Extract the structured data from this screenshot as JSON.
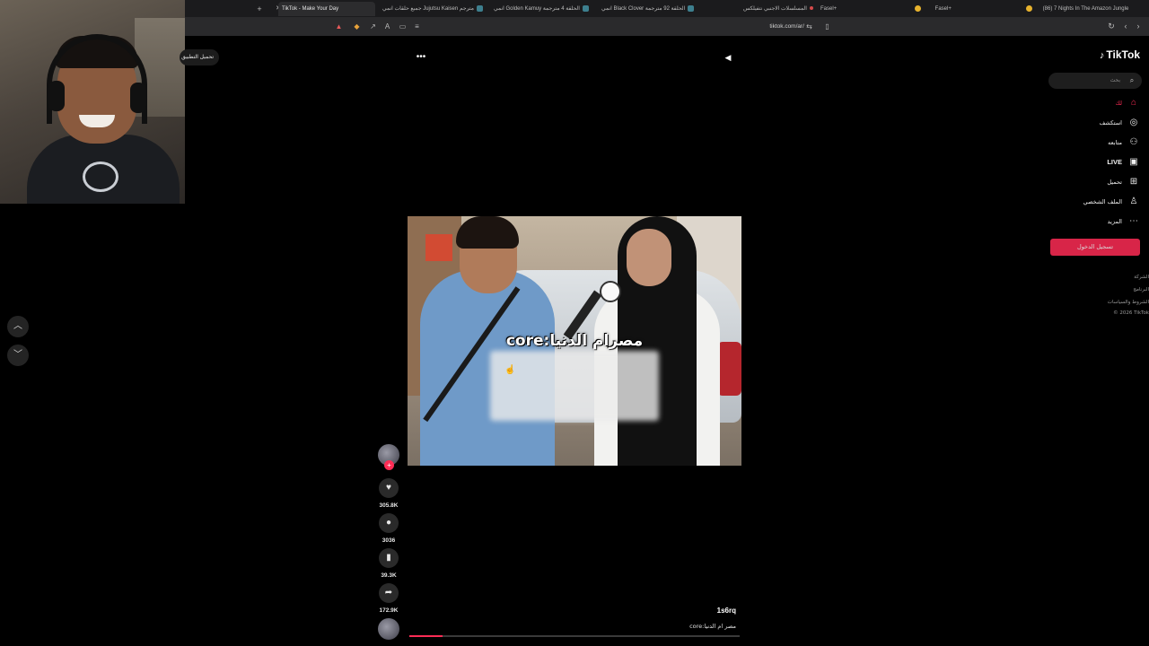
{
  "browser": {
    "tabs": [
      {
        "label": "TikTok - Make Your Day",
        "active": true
      },
      {
        "label": "جميع حلقات انمي Jujutsu Kaisen مترجم"
      },
      {
        "label": "انمي Golden Kamuy الحلقة 4 مترجمة"
      },
      {
        "label": "انمي Black Clover الحلقة 92 مترجمة"
      },
      {
        "label": "المسلسلات الاجنبي نتفيلكس"
      },
      {
        "label": "Fasel+"
      },
      {
        "label": "Fasel+"
      },
      {
        "label": "(86) 7 Nights In The Amazon Jungle"
      }
    ],
    "url": "tiktok.com/ar/"
  },
  "overlay": {
    "get_app": "تحميل التطبيق",
    "caption": "core:مصرام الدنيا"
  },
  "actions": {
    "likes": "305.8K",
    "comments": "3036",
    "saves": "39.3K",
    "shares": "172.9K"
  },
  "video": {
    "author": "1s6rq",
    "description": "core:مصر ام الدنيا",
    "progress": 0.1
  },
  "sidebar": {
    "brand": "TikTok",
    "search_placeholder": "بحث",
    "nav": [
      {
        "label": "لك",
        "icon": "home-icon",
        "active": true
      },
      {
        "label": "استكشف",
        "icon": "compass-icon"
      },
      {
        "label": "متابعه",
        "icon": "following-icon"
      },
      {
        "label": "LIVE",
        "icon": "live-icon"
      },
      {
        "label": "تحميل",
        "icon": "upload-icon"
      },
      {
        "label": "الملف الشخصي",
        "icon": "profile-icon"
      },
      {
        "label": "المزيد",
        "icon": "more-icon"
      }
    ],
    "login": "تسجيل الدخول",
    "footer": [
      "الشركة",
      "البرنامج",
      "الشروط والسياسات",
      "© 2026 TikTok"
    ]
  },
  "colors": {
    "accent": "#fe2c55",
    "background": "#000000"
  }
}
